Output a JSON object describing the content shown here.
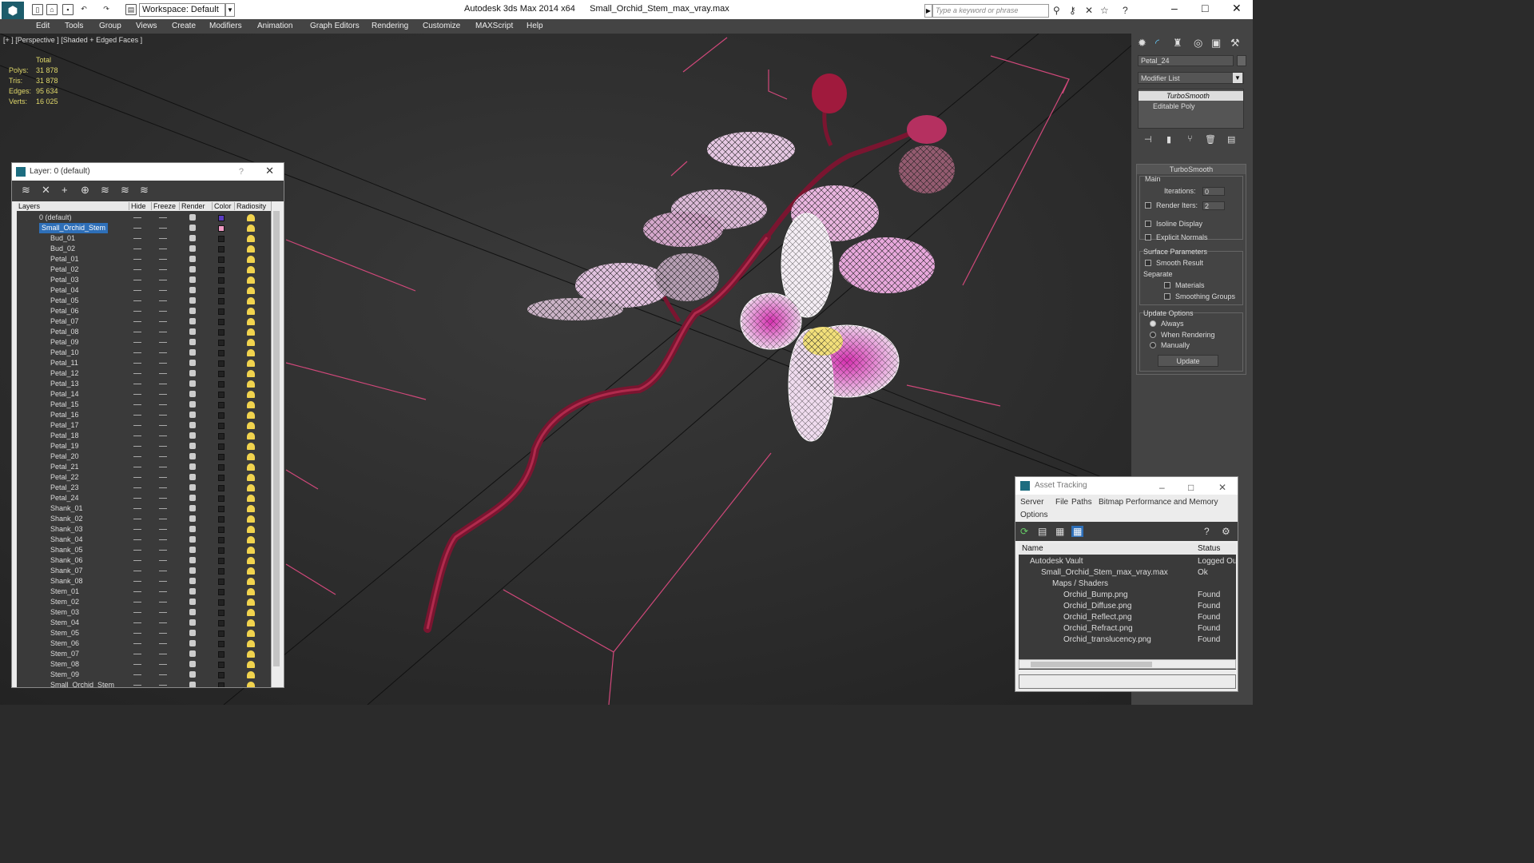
{
  "app": {
    "title_prefix": "Autodesk 3ds Max 2014 x64",
    "filename": "Small_Orchid_Stem_max_vray.max",
    "workspace": "Workspace: Default",
    "search_placeholder": "Type a keyword or phrase"
  },
  "menu": [
    "Edit",
    "Tools",
    "Group",
    "Views",
    "Create",
    "Modifiers",
    "Animation",
    "Graph Editors",
    "Rendering",
    "Customize",
    "MAXScript",
    "Help"
  ],
  "viewport": {
    "label": "[+ ] [Perspective ] [Shaded + Edged Faces ]",
    "stats": {
      "total_label": "Total",
      "rows": [
        {
          "k": "Polys:",
          "v": "31 878"
        },
        {
          "k": "Tris:",
          "v": "31 878"
        },
        {
          "k": "Edges:",
          "v": "95 634"
        },
        {
          "k": "Verts:",
          "v": "16 025"
        }
      ]
    }
  },
  "layer_window": {
    "title": "Layer: 0 (default)",
    "help": "?",
    "columns": [
      "Layers",
      "Hide",
      "Freeze",
      "Render",
      "Color",
      "Radiosity"
    ],
    "rows": [
      {
        "name": "0 (default)",
        "color": "#5a3cc0"
      },
      {
        "name": "Small_Orchid_Stem",
        "color": "#f19ac4",
        "selected": true
      },
      {
        "name": "Bud_01"
      },
      {
        "name": "Bud_02"
      },
      {
        "name": "Petal_01"
      },
      {
        "name": "Petal_02"
      },
      {
        "name": "Petal_03"
      },
      {
        "name": "Petal_04"
      },
      {
        "name": "Petal_05"
      },
      {
        "name": "Petal_06"
      },
      {
        "name": "Petal_07"
      },
      {
        "name": "Petal_08"
      },
      {
        "name": "Petal_09"
      },
      {
        "name": "Petal_10"
      },
      {
        "name": "Petal_11"
      },
      {
        "name": "Petal_12"
      },
      {
        "name": "Petal_13"
      },
      {
        "name": "Petal_14"
      },
      {
        "name": "Petal_15"
      },
      {
        "name": "Petal_16"
      },
      {
        "name": "Petal_17"
      },
      {
        "name": "Petal_18"
      },
      {
        "name": "Petal_19"
      },
      {
        "name": "Petal_20"
      },
      {
        "name": "Petal_21"
      },
      {
        "name": "Petal_22"
      },
      {
        "name": "Petal_23"
      },
      {
        "name": "Petal_24"
      },
      {
        "name": "Shank_01"
      },
      {
        "name": "Shank_02"
      },
      {
        "name": "Shank_03"
      },
      {
        "name": "Shank_04"
      },
      {
        "name": "Shank_05"
      },
      {
        "name": "Shank_06"
      },
      {
        "name": "Shank_07"
      },
      {
        "name": "Shank_08"
      },
      {
        "name": "Stem_01"
      },
      {
        "name": "Stem_02"
      },
      {
        "name": "Stem_03"
      },
      {
        "name": "Stem_04"
      },
      {
        "name": "Stem_05"
      },
      {
        "name": "Stem_06"
      },
      {
        "name": "Stem_07"
      },
      {
        "name": "Stem_08"
      },
      {
        "name": "Stem_09"
      },
      {
        "name": "Small_Orchid_Stem"
      }
    ]
  },
  "command_panel": {
    "object_name": "Petal_24",
    "modifier_list": "Modifier List",
    "stack": [
      "TurboSmooth",
      "Editable Poly"
    ],
    "rollout_title": "TurboSmooth",
    "main_label": "Main",
    "iterations_label": "Iterations:",
    "iterations_value": "0",
    "render_iters_label": "Render Iters:",
    "render_iters_value": "2",
    "isoline": "Isoline Display",
    "explicit_normals": "Explicit Normals",
    "surface_params": "Surface Parameters",
    "smooth_result": "Smooth Result",
    "separate": "Separate",
    "materials": "Materials",
    "smoothing_groups": "Smoothing Groups",
    "update_options": "Update Options",
    "always": "Always",
    "when_rendering": "When Rendering",
    "manually": "Manually",
    "update_btn": "Update"
  },
  "asset_window": {
    "title": "Asset Tracking",
    "menu": [
      "Server",
      "File",
      "Paths",
      "Bitmap Performance and Memory",
      "Options"
    ],
    "columns": [
      "Name",
      "Status"
    ],
    "rows": [
      {
        "name": "Autodesk Vault",
        "status": "Logged Ou",
        "indent": 0
      },
      {
        "name": "Small_Orchid_Stem_max_vray.max",
        "status": "Ok",
        "indent": 1
      },
      {
        "name": "Maps / Shaders",
        "status": "",
        "indent": 2
      },
      {
        "name": "Orchid_Bump.png",
        "status": "Found",
        "indent": 3
      },
      {
        "name": "Orchid_Diffuse.png",
        "status": "Found",
        "indent": 3
      },
      {
        "name": "Orchid_Reflect.png",
        "status": "Found",
        "indent": 3
      },
      {
        "name": "Orchid_Refract.png",
        "status": "Found",
        "indent": 3
      },
      {
        "name": "Orchid_translucency.png",
        "status": "Found",
        "indent": 3
      }
    ]
  },
  "colors": {
    "selection": "#2e6fb8",
    "bg": "#2c2c2c",
    "stem": "#8a1a35",
    "petal": "#e8a6d6"
  }
}
